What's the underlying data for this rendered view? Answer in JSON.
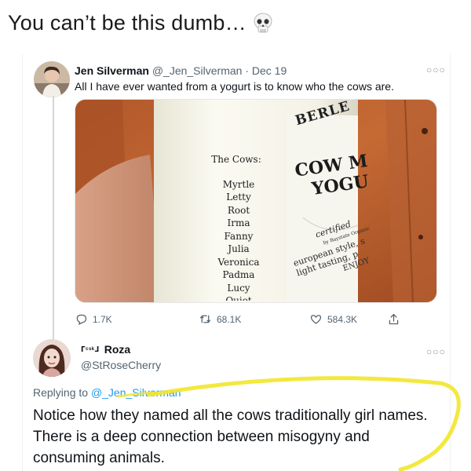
{
  "caption": {
    "text": "You can’t be this dumb…",
    "emoji": "skull-icon"
  },
  "tweet_original": {
    "name": "Jen Silverman",
    "handle_date": "@_Jen_Silverman · Dec 19",
    "text": "All I have ever wanted from a yogurt is to know who the cows are.",
    "photo": {
      "heading": "The Cows:",
      "cows": [
        "Myrtle",
        "Letty",
        "Root",
        "Irma",
        "Fanny",
        "Julia",
        "Veronica",
        "Padma",
        "Lucy",
        "Quiet"
      ],
      "label_lines": [
        "BERLE",
        "COW M",
        "YOGU",
        "certified",
        "by Baystate Organic",
        "european style, s",
        "light tasting, p",
        "ENJOY"
      ]
    },
    "stats": {
      "replies": "1.7K",
      "retweets": "68.1K",
      "likes": "584.3K"
    }
  },
  "tweet_reply": {
    "flag": "ᒥᶜˢᵏᒧ",
    "name": "Roza",
    "handle": "@StRoseCherry",
    "replying_prefix": "Replying to",
    "replying_handle": "@_Jen_Silverman",
    "text": "Notice how they named all the cows traditionally girl names. There is a deep connection between misogyny and consuming animals."
  },
  "colors": {
    "link_blue": "#1d9bf0",
    "secondary_gray": "#536471",
    "highlighter_yellow": "#f2e52a"
  }
}
